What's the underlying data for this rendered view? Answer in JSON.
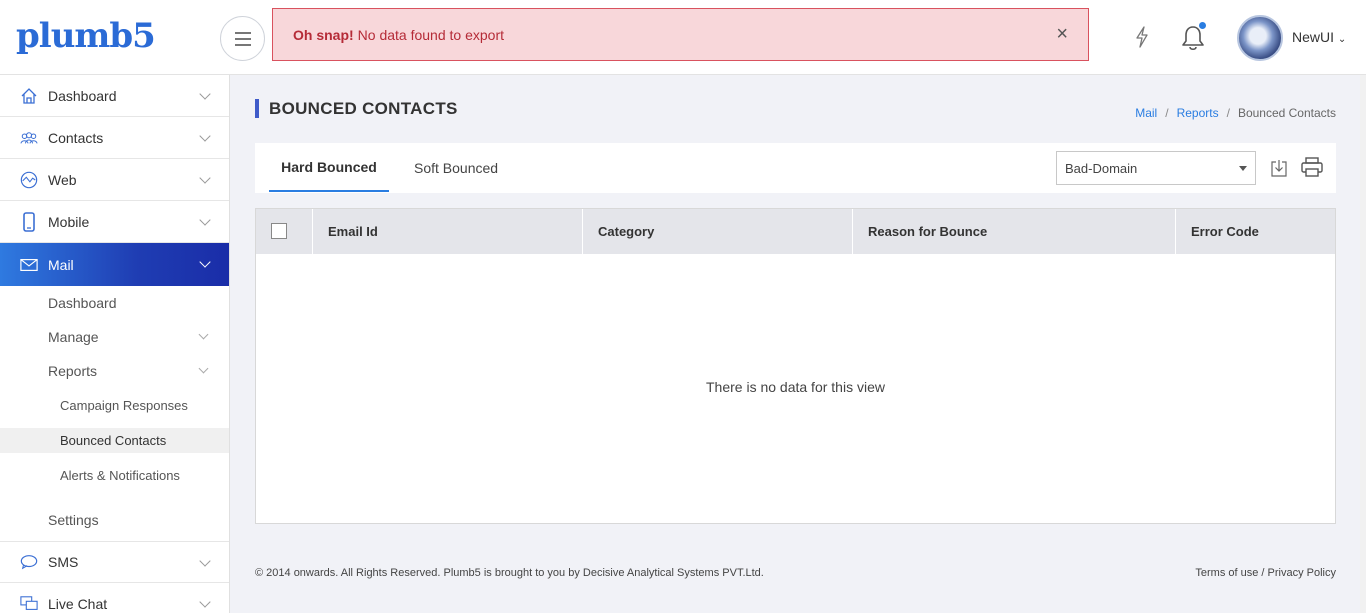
{
  "header": {
    "logo": "plumb5",
    "alert_strong": "Oh snap!",
    "alert_text": "No data found to export",
    "alert_close": "×",
    "user_name": "NewUI"
  },
  "sidebar": {
    "items": [
      {
        "label": "Dashboard",
        "icon": "home-icon"
      },
      {
        "label": "Contacts",
        "icon": "contacts-icon"
      },
      {
        "label": "Web",
        "icon": "web-icon"
      },
      {
        "label": "Mobile",
        "icon": "mobile-icon"
      },
      {
        "label": "Mail",
        "icon": "mail-icon"
      }
    ],
    "mail_sub": {
      "dashboard": "Dashboard",
      "manage": "Manage",
      "reports": "Reports",
      "campaign_responses": "Campaign Responses",
      "bounced_contacts": "Bounced Contacts",
      "alerts": "Alerts & Notifications",
      "settings": "Settings"
    },
    "bottom_items": [
      {
        "label": "SMS",
        "icon": "sms-icon"
      },
      {
        "label": "Live Chat",
        "icon": "live-chat-icon"
      }
    ]
  },
  "page": {
    "title": "BOUNCED CONTACTS",
    "breadcrumb": [
      "Mail",
      "Reports",
      "Bounced Contacts"
    ],
    "tabs": [
      "Hard Bounced",
      "Soft Bounced"
    ],
    "filter_value": "Bad-Domain",
    "columns": [
      "Email Id",
      "Category",
      "Reason for Bounce",
      "Error Code"
    ],
    "empty_text": "There is no data for this view"
  },
  "footer": {
    "copyright": "© 2014 onwards. All Rights Reserved. Plumb5 is brought to you by Decisive Analytical Systems PVT.Ltd.",
    "terms": "Terms of use",
    "sep": " / ",
    "privacy": "Privacy Policy"
  },
  "colors": {
    "accent": "#2a7de1",
    "active_nav_start": "#2f7ae0",
    "active_nav_end": "#1a2da8",
    "alert_bg": "#f8d7da",
    "alert_text": "#b52b37"
  }
}
